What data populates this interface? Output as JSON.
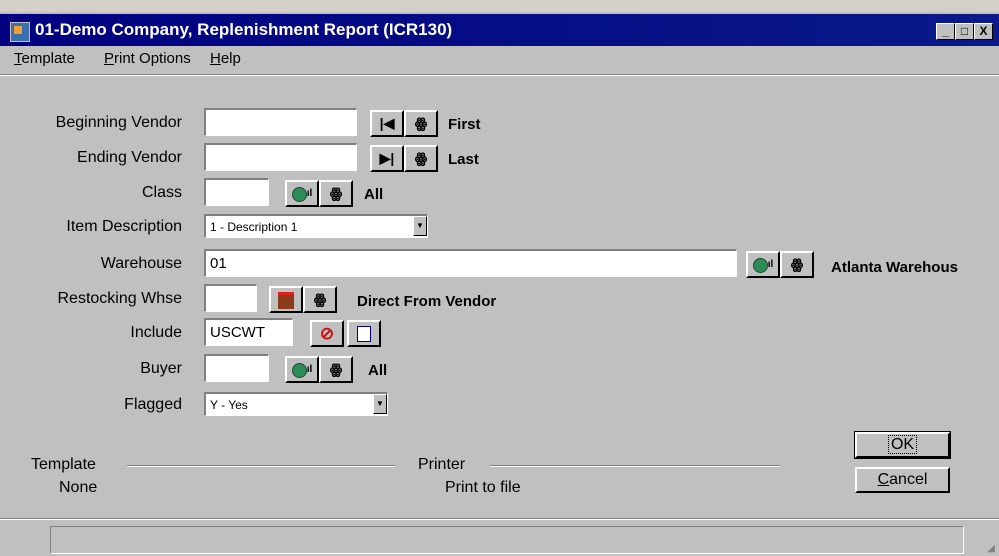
{
  "window": {
    "title": "01-Demo Company, Replenishment Report (ICR130)",
    "controls": {
      "minimize": "_",
      "maximize": "□",
      "close": "X"
    }
  },
  "menu": {
    "items": [
      {
        "first": "T",
        "rest": "emplate"
      },
      {
        "first": "P",
        "rest": "rint Options"
      },
      {
        "first": "H",
        "rest": "elp"
      }
    ]
  },
  "form": {
    "beginning_vendor": {
      "label": "Beginning Vendor",
      "value": "",
      "hint": "First"
    },
    "ending_vendor": {
      "label": "Ending Vendor",
      "value": "",
      "hint": "Last"
    },
    "class": {
      "label": "Class",
      "value": "",
      "hint": "All"
    },
    "item_description": {
      "label": "Item Description",
      "selected": "1 - Description 1"
    },
    "warehouse": {
      "label": "Warehouse",
      "value": "01",
      "hint": "Atlanta Warehous"
    },
    "restocking_whse": {
      "label": "Restocking Whse",
      "value": "",
      "hint": "Direct From Vendor"
    },
    "include": {
      "label": "Include",
      "value": "USCWT"
    },
    "buyer": {
      "label": "Buyer",
      "value": "",
      "hint": "All"
    },
    "flagged": {
      "label": "Flagged",
      "selected": "Y - Yes"
    }
  },
  "template_section": {
    "label": "Template",
    "value": "None"
  },
  "printer_section": {
    "label": "Printer",
    "value": "Print to file"
  },
  "buttons": {
    "ok": "OK",
    "cancel_first": "C",
    "cancel_rest": "ancel"
  },
  "icons": {
    "first": "first-record-icon",
    "last": "last-record-icon",
    "find": "binoculars-icon",
    "lookup": "globe-lookup-icon",
    "direct": "direct-vendor-icon",
    "clear": "no-entry-icon",
    "select": "select-list-icon"
  }
}
